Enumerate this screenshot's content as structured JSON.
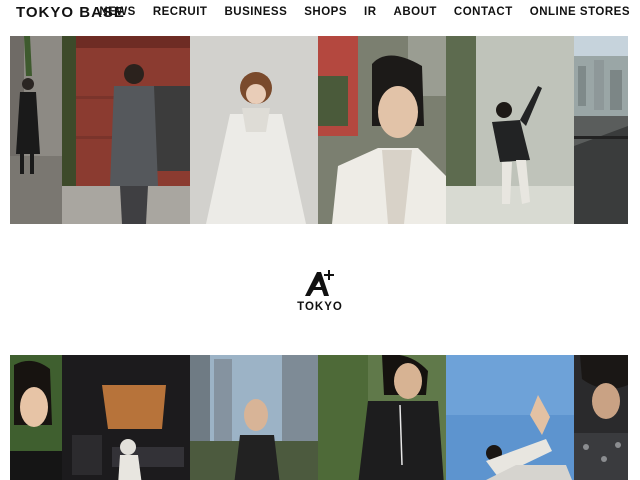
{
  "header": {
    "logo": "TOKYO BASE",
    "nav": [
      "NEWS",
      "RECRUIT",
      "BUSINESS",
      "SHOPS",
      "IR",
      "ABOUT",
      "CONTACT",
      "ONLINE STORES"
    ]
  },
  "brand": {
    "name": "TOKYO",
    "logo_mark": "A+"
  },
  "gallery_top": [
    "woman in dark outfit walking on street",
    "man in grey jacket and hoodie walking",
    "woman in white parka",
    "man in white jacket close-up",
    "dancer in black jacket posing",
    "city view from balcony"
  ],
  "gallery_bottom": [
    "woman with hand raised",
    "music studio interior",
    "woman with headphones on city street",
    "man in sleeveless top with earphones",
    "woman stretching against blue sky",
    "man in patterned shirt"
  ],
  "colors": {
    "text": "#111111",
    "background": "#ffffff"
  }
}
